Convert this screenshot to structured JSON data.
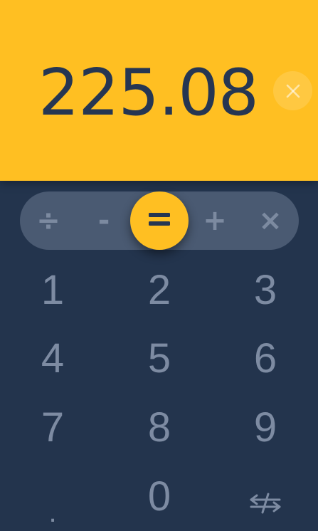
{
  "display": {
    "value": "225.08",
    "clear_icon": "close-icon"
  },
  "operators": {
    "divide": "÷",
    "subtract": "-",
    "equals_icon": "equals-icon",
    "add": "+",
    "multiply": "×"
  },
  "keypad": {
    "keys": [
      "1",
      "2",
      "3",
      "4",
      "5",
      "6",
      "7",
      "8",
      "9",
      ".",
      "0"
    ],
    "backspace_icon": "backspace-not-equal-arrows-icon"
  },
  "colors": {
    "display_background": "#ffbf22",
    "keypad_background": "#23344d",
    "operator_bar": "#4a5a72",
    "key_text": "#7d8ba2",
    "display_text": "#263652"
  }
}
